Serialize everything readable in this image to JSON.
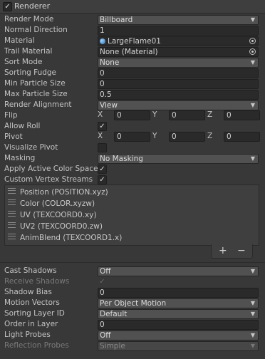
{
  "header": {
    "title": "Renderer",
    "checked": "✓"
  },
  "rows": {
    "render_mode": {
      "label": "Render Mode",
      "value": "Billboard"
    },
    "normal_direction": {
      "label": "Normal Direction",
      "value": "1"
    },
    "material": {
      "label": "Material",
      "value": "LargeFlame01"
    },
    "trail_material": {
      "label": "Trail Material",
      "value": "None (Material)"
    },
    "sort_mode": {
      "label": "Sort Mode",
      "value": "None"
    },
    "sorting_fudge": {
      "label": "Sorting Fudge",
      "value": "0"
    },
    "min_particle_size": {
      "label": "Min Particle Size",
      "value": "0"
    },
    "max_particle_size": {
      "label": "Max Particle Size",
      "value": "0.5"
    },
    "render_alignment": {
      "label": "Render Alignment",
      "value": "View"
    },
    "flip": {
      "label": "Flip",
      "x": "0",
      "y": "0",
      "z": "0"
    },
    "allow_roll": {
      "label": "Allow Roll",
      "checked": "✓"
    },
    "pivot": {
      "label": "Pivot",
      "x": "0",
      "y": "0",
      "z": "0"
    },
    "visualize_pivot": {
      "label": "Visualize Pivot",
      "checked": ""
    },
    "masking": {
      "label": "Masking",
      "value": "No Masking"
    },
    "apply_active_color_space": {
      "label": "Apply Active Color Space",
      "checked": "✓"
    },
    "custom_vertex_streams": {
      "label": "Custom Vertex Streams",
      "checked": "✓"
    },
    "cast_shadows": {
      "label": "Cast Shadows",
      "value": "Off"
    },
    "receive_shadows": {
      "label": "Receive Shadows",
      "checked": "✓"
    },
    "shadow_bias": {
      "label": "Shadow Bias",
      "value": "0"
    },
    "motion_vectors": {
      "label": "Motion Vectors",
      "value": "Per Object Motion"
    },
    "sorting_layer_id": {
      "label": "Sorting Layer ID",
      "value": "Default"
    },
    "order_in_layer": {
      "label": "Order in Layer",
      "value": "0"
    },
    "light_probes": {
      "label": "Light Probes",
      "value": "Off"
    },
    "reflection_probes": {
      "label": "Reflection Probes",
      "value": "Simple"
    }
  },
  "axis_labels": {
    "x": "X",
    "y": "Y",
    "z": "Z"
  },
  "vertex_streams": [
    "Position (POSITION.xyz)",
    "Color (COLOR.xyzw)",
    "UV (TEXCOORD0.xy)",
    "UV2 (TEXCOORD0.zw)",
    "AnimBlend (TEXCOORD1.x)"
  ],
  "list_buttons": {
    "add": "+",
    "remove": "−"
  },
  "icons": {
    "dropdown": "▼"
  }
}
